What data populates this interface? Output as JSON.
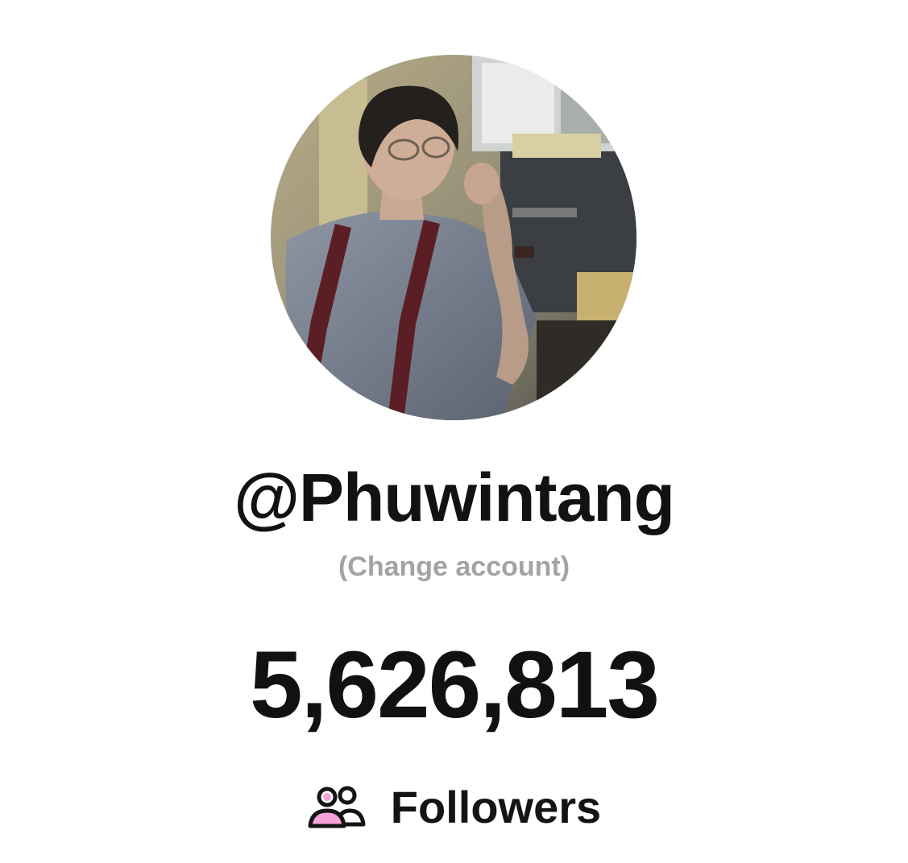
{
  "profile": {
    "handle": "@Phuwintang",
    "change_account": "(Change account)",
    "avatar_icon": "profile-photo"
  },
  "stats": {
    "followers_count": "5,626,813",
    "followers_label": "Followers",
    "followers_icon": "users-icon",
    "icon_accent": "#f4a2d8"
  }
}
